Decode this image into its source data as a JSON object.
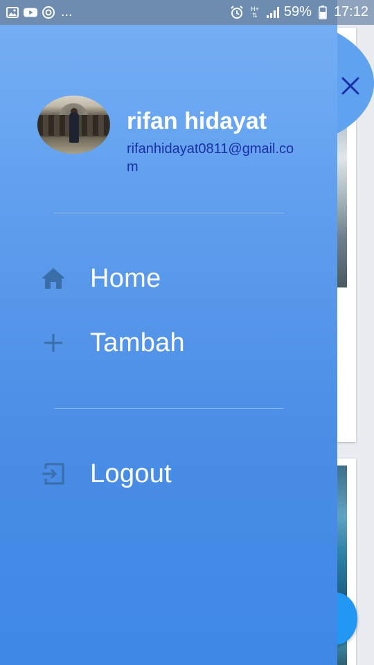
{
  "status_bar": {
    "left_icons": [
      "image-icon",
      "youtube-icon",
      "sync-icon"
    ],
    "overflow": "...",
    "right_icons": [
      "alarm-icon",
      "hplus-data-icon",
      "signal-icon",
      "battery-icon"
    ],
    "network": "H+",
    "battery": "59%",
    "time": "17:12"
  },
  "drawer": {
    "user": {
      "name": "rifan hidayat",
      "email": "rifanhidayat0811@gmail.com"
    },
    "menu": [
      {
        "label": "Home",
        "icon": "home-icon"
      },
      {
        "label": "Tambah",
        "icon": "plus-icon"
      }
    ],
    "secondary_menu": [
      {
        "label": "Logout",
        "icon": "logout-icon"
      }
    ],
    "colors": {
      "top": "#74aef5",
      "bottom": "#3f88e6",
      "icon": "#3a6ea8",
      "email": "#1a2ea8"
    }
  },
  "overlay": {
    "close_icon": "close-icon",
    "fab_color": "#2196f3"
  }
}
